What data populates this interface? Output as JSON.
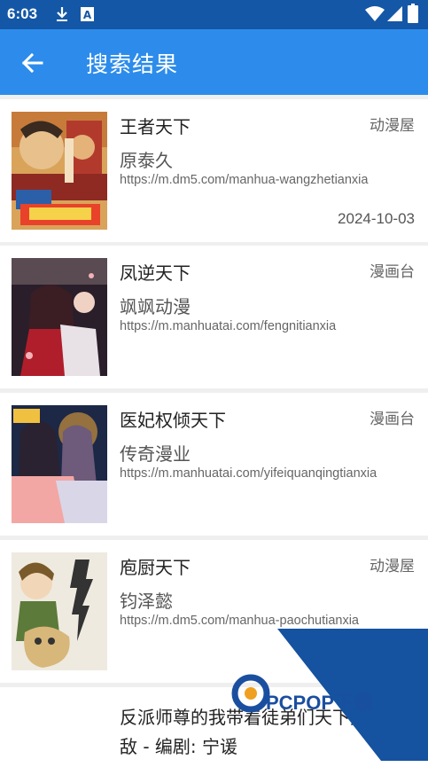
{
  "status": {
    "time": "6:03",
    "icons": [
      "download-icon",
      "notification-a-icon",
      "wifi-icon",
      "signal-icon",
      "battery-icon"
    ]
  },
  "app_bar": {
    "title": "搜索结果",
    "back_icon": "arrow-back-icon"
  },
  "results": [
    {
      "title": "王者天下",
      "source": "动漫屋",
      "author": "原泰久",
      "url": "https://m.dm5.com/manhua-wangzhetianxia",
      "date": "2024-10-03"
    },
    {
      "title": "凤逆天下",
      "source": "漫画台",
      "author": "飒飒动漫",
      "url": "https://m.manhuatai.com/fengnitianxia"
    },
    {
      "title": "医妃权倾天下",
      "source": "漫画台",
      "author": "传奇漫业",
      "url": "https://m.manhuatai.com/yifeiquanqingtianxia"
    },
    {
      "title": "庖厨天下",
      "source": "动漫屋",
      "author": "钧泽懿",
      "url": "https://m.dm5.com/manhua-paochutianxia"
    },
    {
      "title": "反派师尊的我带着徒弟们天下无敌 - 编剧: 宁谖"
    }
  ],
  "colors": {
    "status_bar": "#1457a6",
    "app_bar": "#2d8ceb",
    "card": "#ffffff",
    "background": "#efefef"
  },
  "watermark": {
    "text": "PCPOP下载"
  }
}
